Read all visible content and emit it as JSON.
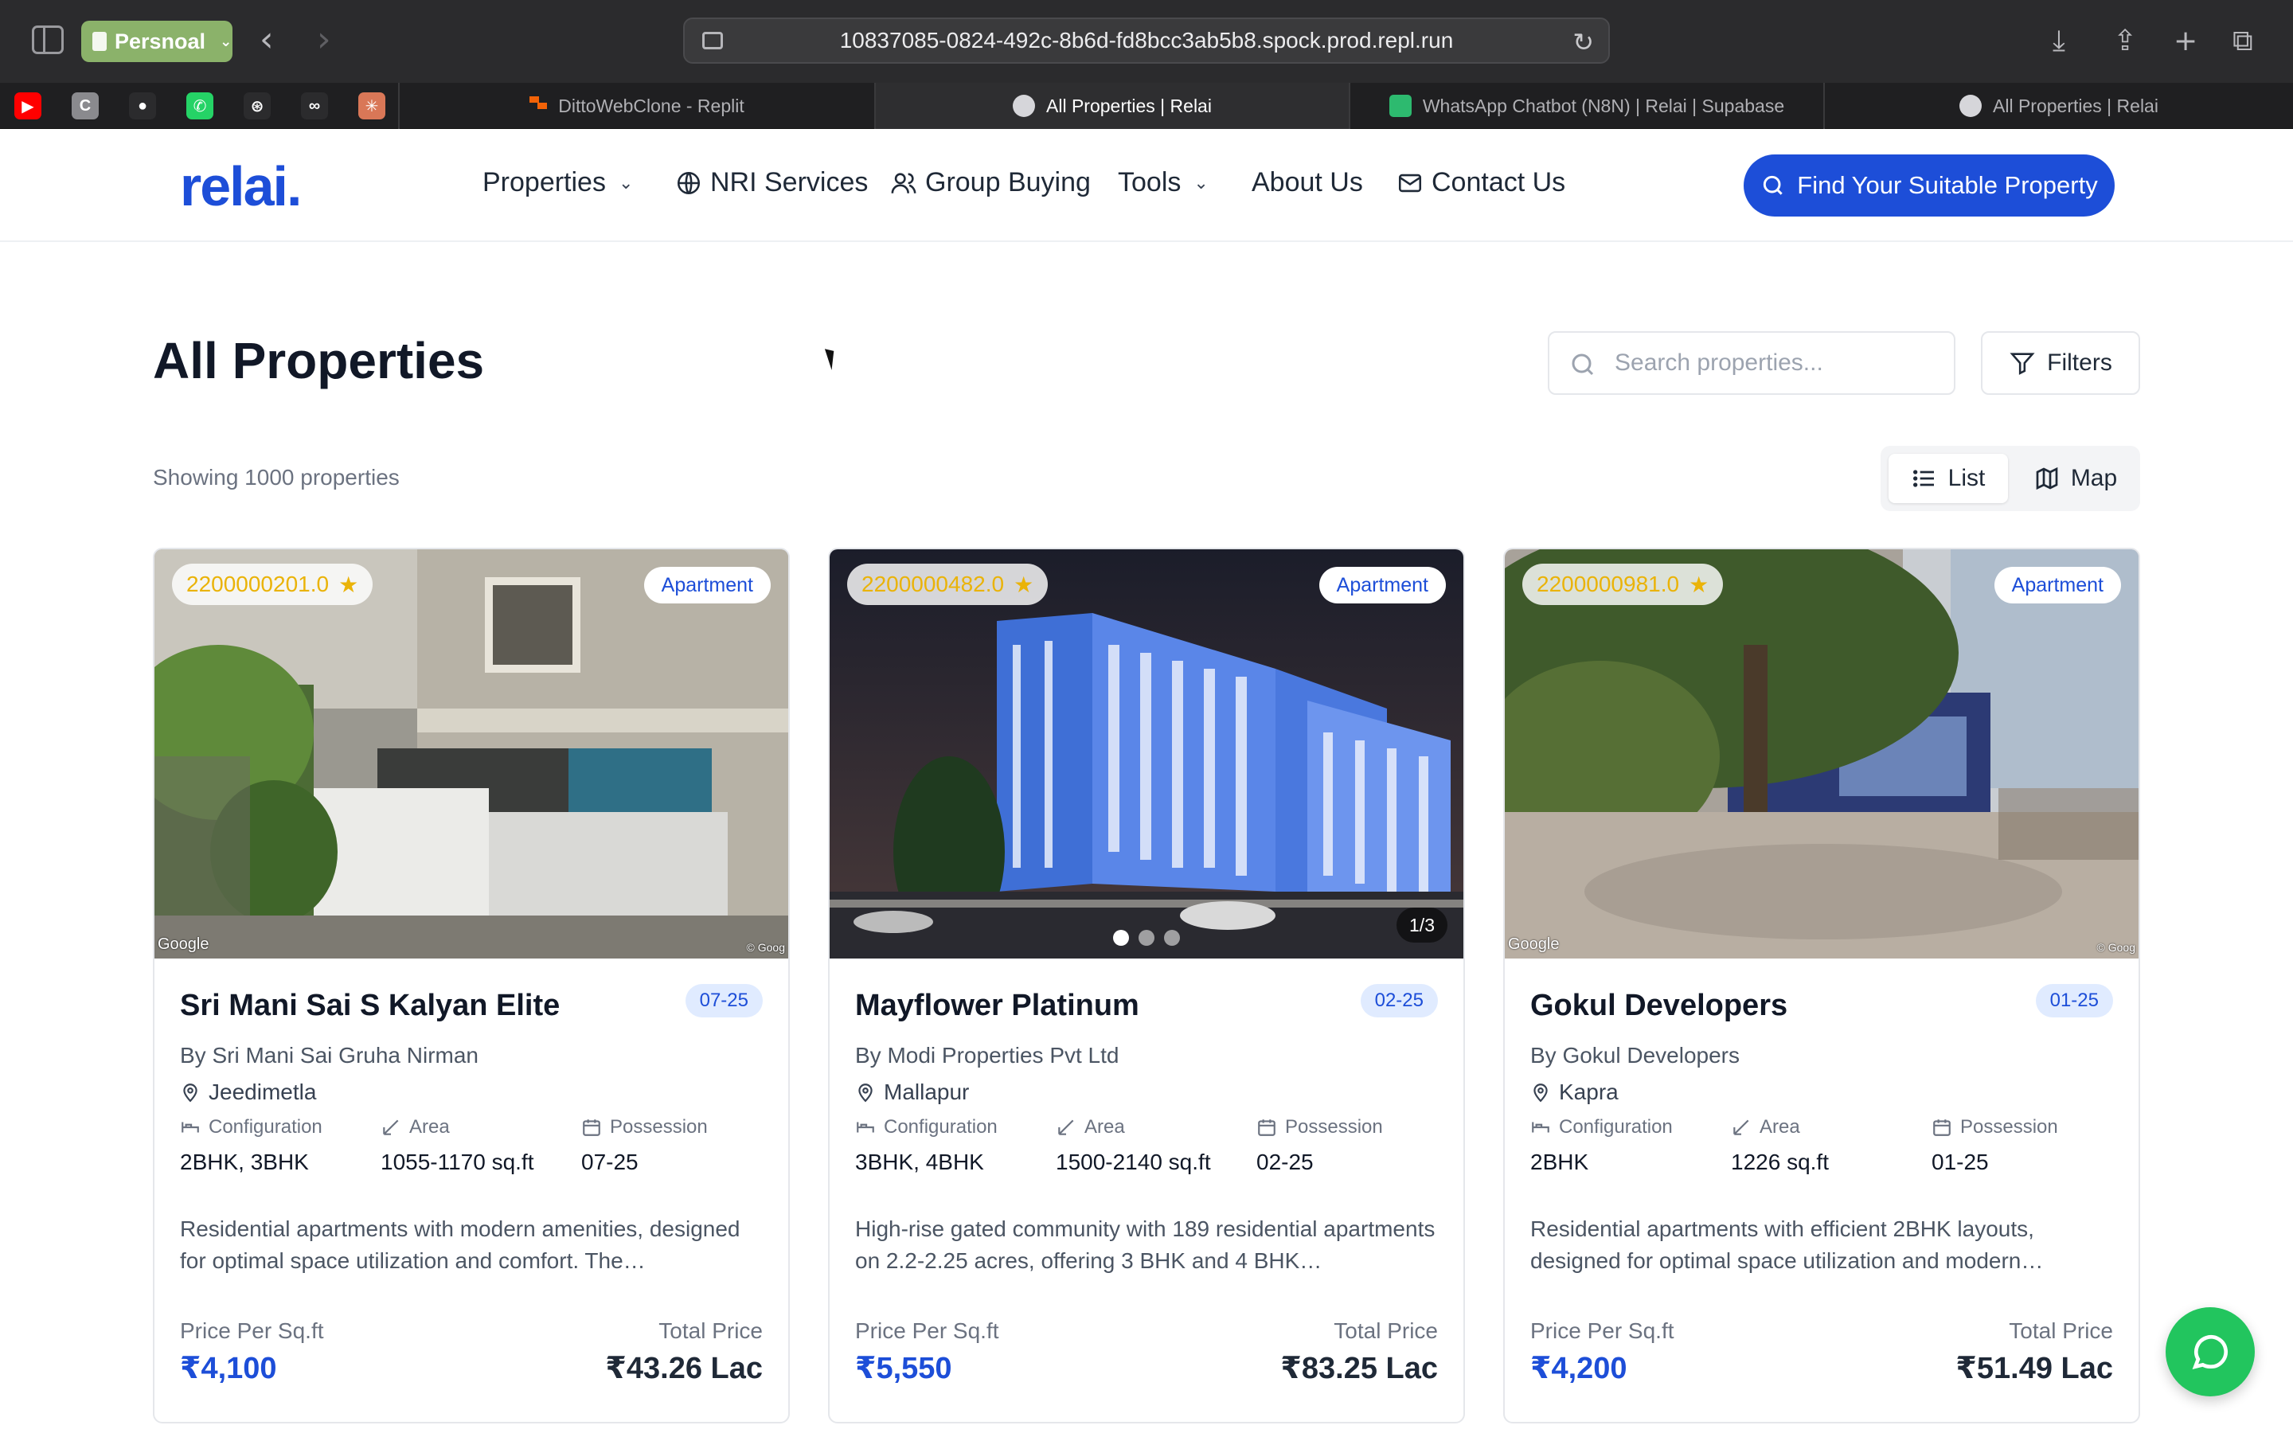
{
  "browser": {
    "profile_label": "Persnoal",
    "url": "10837085-0824-492c-8b6d-fd8bcc3ab5b8.spock.prod.repl.run",
    "pinned_favicons": [
      {
        "name": "youtube-icon",
        "color": "#ff0000",
        "glyph": "▶"
      },
      {
        "name": "c-app-icon",
        "color": "#8a8a8e",
        "glyph": "C"
      },
      {
        "name": "github-icon",
        "color": "#2b2b2d",
        "glyph": "●"
      },
      {
        "name": "whatsapp-icon",
        "color": "#25d366",
        "glyph": "✆"
      },
      {
        "name": "openai-icon",
        "color": "#2b2b2d",
        "glyph": "⊛"
      },
      {
        "name": "infinity-icon",
        "color": "#2b2b2d",
        "glyph": "∞"
      },
      {
        "name": "claude-icon",
        "color": "#d97757",
        "glyph": "✳"
      }
    ],
    "tabs": [
      {
        "title": "DittoWebClone - Replit",
        "active": false
      },
      {
        "title": "All Properties | Relai",
        "active": true
      },
      {
        "title": "WhatsApp Chatbot (N8N) | Relai | Supabase",
        "active": false
      },
      {
        "title": "All Properties | Relai",
        "active": false
      }
    ]
  },
  "header": {
    "logo": "relai.",
    "nav": {
      "properties": "Properties",
      "nri": "NRI Services",
      "group_buying": "Group Buying",
      "tools": "Tools",
      "about": "About Us",
      "contact": "Contact Us"
    },
    "cta": "Find Your Suitable Property"
  },
  "page": {
    "title": "All Properties",
    "search_placeholder": "Search properties...",
    "filters_label": "Filters",
    "showing_text": "Showing 1000 properties",
    "view_list": "List",
    "view_map": "Map"
  },
  "labels": {
    "configuration": "Configuration",
    "area": "Area",
    "possession": "Possession",
    "price_per_sqft": "Price Per Sq.ft",
    "total_price": "Total Price"
  },
  "cards": [
    {
      "rating": "2200000201.0",
      "type": "Apartment",
      "date": "07-25",
      "title": "Sri Mani Sai S Kalyan Elite",
      "builder": "By Sri Mani Sai Gruha Nirman",
      "locality": "Jeedimetla",
      "configuration": "2BHK, 3BHK",
      "area": "1055-1170 sq.ft",
      "possession": "07-25",
      "description": "Residential apartments with modern amenities, designed for optimal space utilization and comfort. The…",
      "price_per_sqft": "₹4,100",
      "total_price": "₹43.26 Lac",
      "google_label": "Google",
      "google_copy": "© Goog"
    },
    {
      "rating": "2200000482.0",
      "type": "Apartment",
      "date": "02-25",
      "title": "Mayflower Platinum",
      "builder": "By Modi Properties Pvt Ltd",
      "locality": "Mallapur",
      "configuration": "3BHK, 4BHK",
      "area": "1500-2140 sq.ft",
      "possession": "02-25",
      "description": "High-rise gated community with 189 residential apartments on 2.2-2.25 acres, offering 3 BHK and 4 BHK…",
      "price_per_sqft": "₹5,550",
      "total_price": "₹83.25 Lac",
      "image_counter": "1/3"
    },
    {
      "rating": "2200000981.0",
      "type": "Apartment",
      "date": "01-25",
      "title": "Gokul Developers",
      "builder": "By Gokul Developers",
      "locality": "Kapra",
      "configuration": "2BHK",
      "area": "1226 sq.ft",
      "possession": "01-25",
      "description": "Residential apartments with efficient 2BHK layouts, designed for optimal space utilization and modern…",
      "price_per_sqft": "₹4,200",
      "total_price": "₹51.49 Lac",
      "google_label": "Google",
      "google_copy": "© Goog"
    }
  ],
  "colors": {
    "brand": "#1d4ed8",
    "rating": "#eab308",
    "whatsapp": "#22c55e"
  }
}
